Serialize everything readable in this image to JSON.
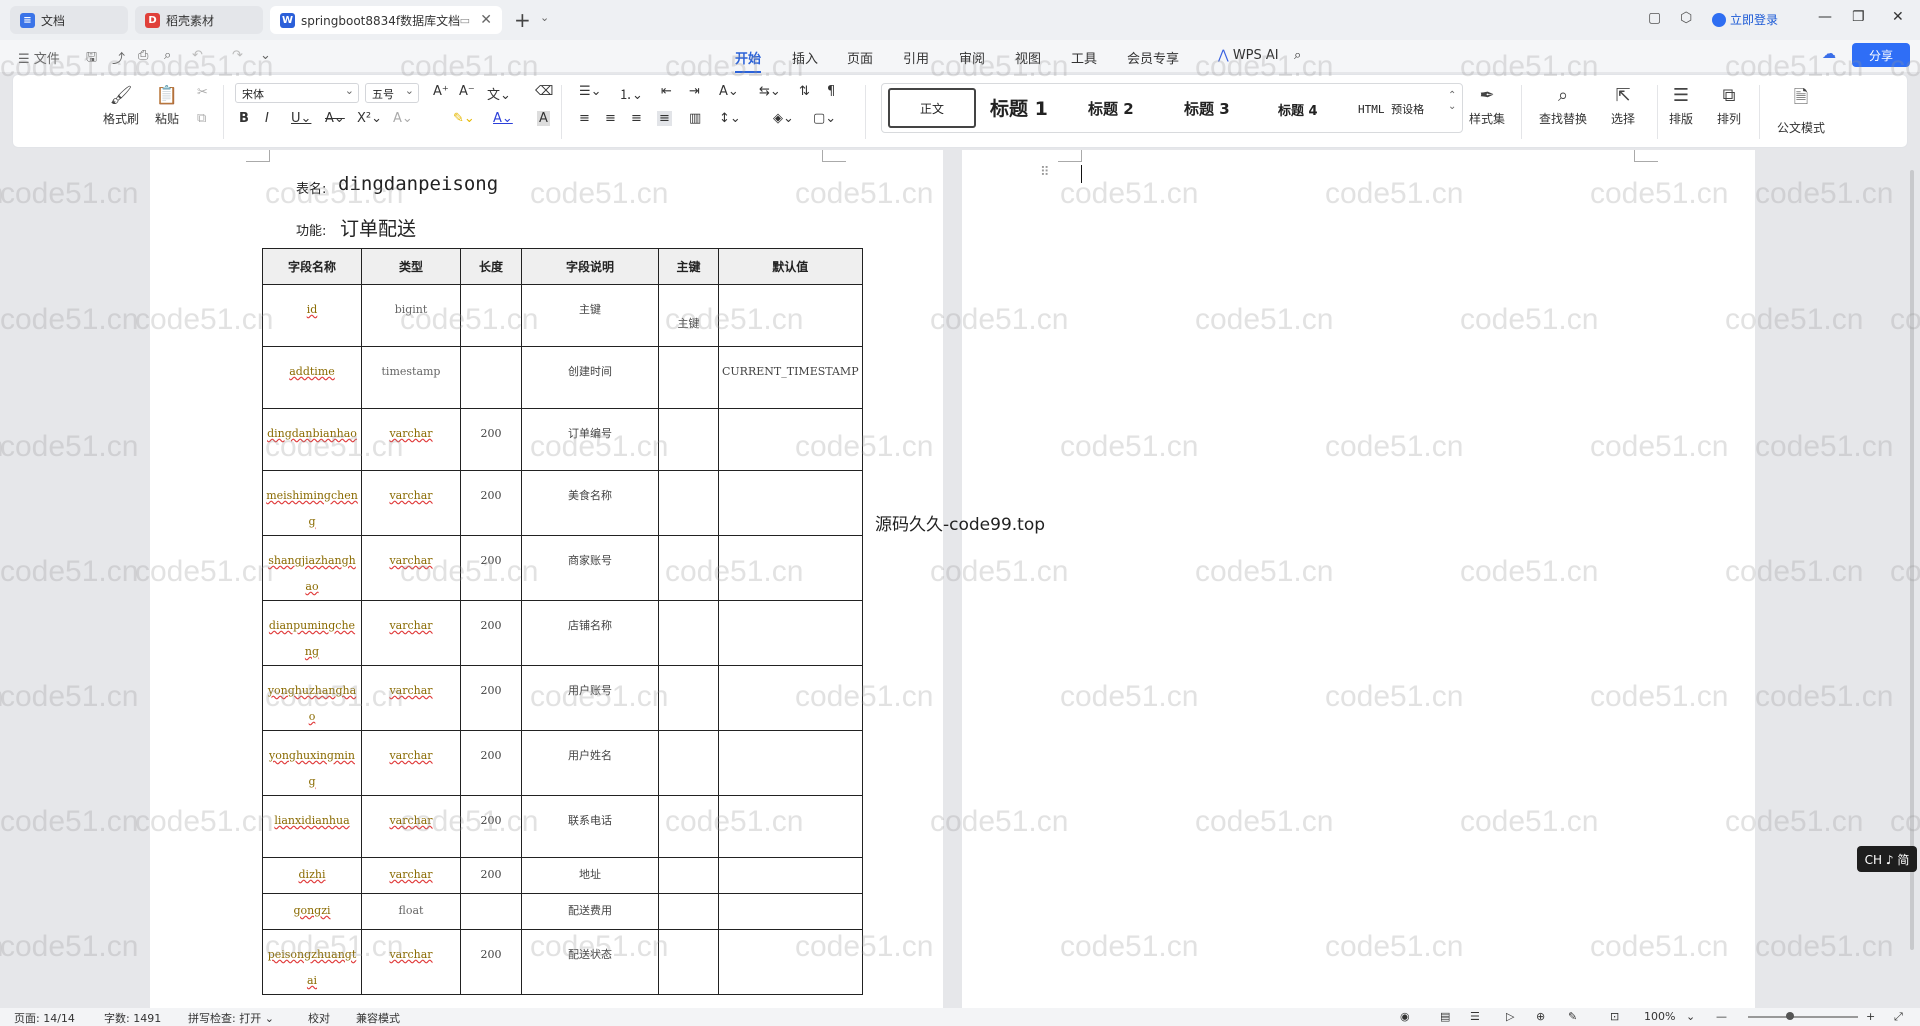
{
  "tabs": [
    {
      "label": "文档",
      "icon": "doc-icon",
      "color": "#3b74e8"
    },
    {
      "label": "稻壳素材",
      "icon": "docer-icon",
      "color": "#e0403a"
    },
    {
      "label": "springboot8834f数据库文档",
      "icon": "word-icon",
      "color": "#2b5fd9"
    }
  ],
  "titlebar": {
    "login": "立即登录",
    "new_tab": "+"
  },
  "menu": {
    "file": "文件",
    "items": [
      "开始",
      "插入",
      "页面",
      "引用",
      "审阅",
      "视图",
      "工具",
      "会员专享"
    ],
    "active": "开始",
    "wps_ai": "WPS AI",
    "share": "分享"
  },
  "ribbon": {
    "format_painter": "格式刷",
    "paste": "粘贴",
    "font_name": "宋体",
    "font_size": "五号",
    "styles": [
      "正文",
      "标题 1",
      "标题 2",
      "标题 3",
      "标题 4",
      "HTML 预设格"
    ],
    "style_set": "样式集",
    "find_replace": "查找替换",
    "select": "选择",
    "layout": "排版",
    "arrange": "排列",
    "official_mode": "公文模式"
  },
  "doc": {
    "table_name_label": "表名:",
    "table_name": "dingdanpeisong",
    "function_label": "功能:",
    "function": "订单配送",
    "headers": [
      "字段名称",
      "类型",
      "长度",
      "字段说明",
      "主键",
      "默认值"
    ],
    "rows": [
      [
        "id",
        "bigint",
        "",
        "主键",
        "主键",
        ""
      ],
      [
        "addtime",
        "timestamp",
        "",
        "创建时间",
        "",
        "CURRENT_TIMESTAMP"
      ],
      [
        "dingdanbianhao",
        "varchar",
        "200",
        "订单编号",
        "",
        ""
      ],
      [
        "meishimingcheng",
        "varchar",
        "200",
        "美食名称",
        "",
        ""
      ],
      [
        "shangjiazhanghao",
        "varchar",
        "200",
        "商家账号",
        "",
        ""
      ],
      [
        "dianpumingcheng",
        "varchar",
        "200",
        "店铺名称",
        "",
        ""
      ],
      [
        "yonghuzhanghao",
        "varchar",
        "200",
        "用户账号",
        "",
        ""
      ],
      [
        "yonghuxingming",
        "varchar",
        "200",
        "用户姓名",
        "",
        ""
      ],
      [
        "lianxidianhua",
        "varchar",
        "200",
        "联系电话",
        "",
        ""
      ],
      [
        "dizhi",
        "varchar",
        "200",
        "地址",
        "",
        ""
      ],
      [
        "gongzi",
        "float",
        "",
        "配送费用",
        "",
        ""
      ],
      [
        "peisongzhuangtai",
        "varchar",
        "200",
        "配送状态",
        "",
        ""
      ]
    ],
    "center_text": "源码久久-code99.top",
    "watermark": "code51.cn"
  },
  "ime": "CH ♪ 简",
  "status": {
    "page": "页面: 14/14",
    "words": "字数: 1491",
    "spell": "拼写检查: 打开",
    "proof": "校对",
    "compat": "兼容模式",
    "zoom": "100%"
  }
}
